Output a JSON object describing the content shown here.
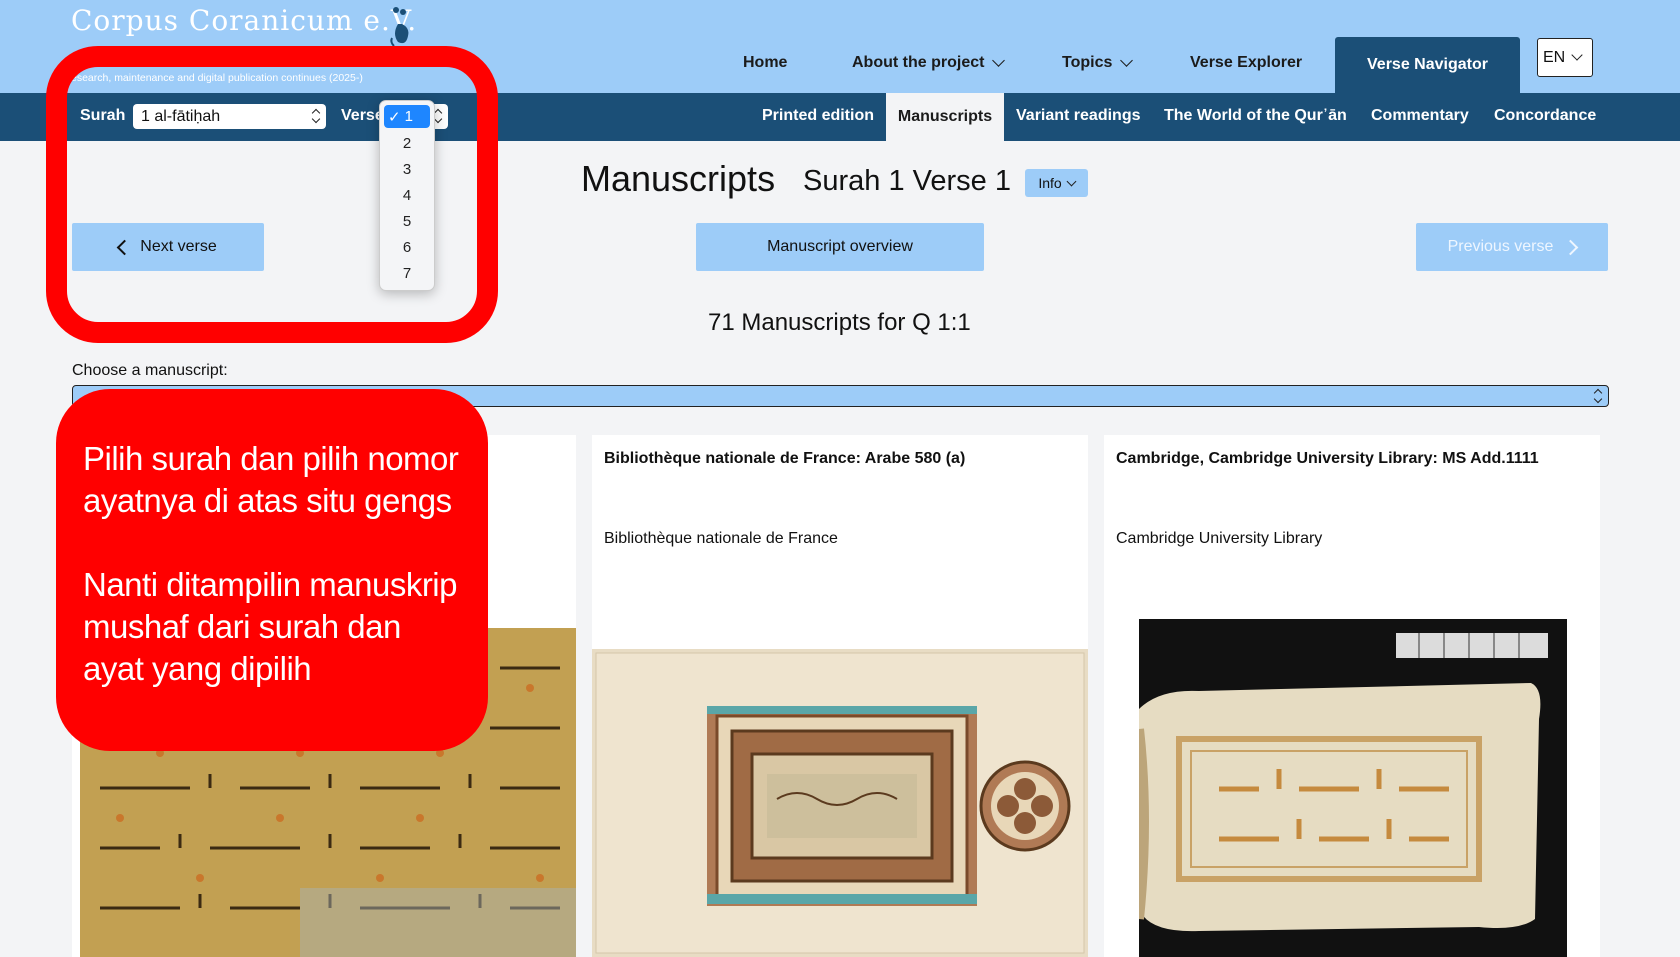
{
  "header": {
    "brand": "Corpus Coranicum e.V.",
    "tagline": "esearch, maintenance and digital publication continues (2025-)",
    "nav": [
      {
        "label": "Home",
        "has_dropdown": false
      },
      {
        "label": "About the project",
        "has_dropdown": true
      },
      {
        "label": "Topics",
        "has_dropdown": true
      },
      {
        "label": "Verse Explorer",
        "has_dropdown": false
      }
    ],
    "nav_active": "Verse Navigator",
    "language": "EN"
  },
  "subbar": {
    "surah_label": "Surah",
    "surah_value": "1 al-fātiḥah",
    "verse_label": "Verse",
    "items": [
      "Printed edition",
      "Variant readings",
      "The World of the Qur᾿ān",
      "Commentary",
      "Concordance"
    ],
    "active_item": "Manuscripts"
  },
  "verse_dropdown": {
    "selected": "1",
    "options": [
      "2",
      "3",
      "4",
      "5",
      "6",
      "7"
    ]
  },
  "main": {
    "title": "Manuscripts",
    "subtitle": "Surah 1 Verse 1",
    "info_label": "Info",
    "next_verse": "Next verse",
    "overview": "Manuscript overview",
    "previous_verse": "Previous verse",
    "count_text": "71 Manuscripts for Q 1:1",
    "choose_label": "Choose a manuscript:"
  },
  "cards": [
    {
      "title": "",
      "library": ""
    },
    {
      "title": "Bibliothèque nationale de France: Arabe 580 (a)",
      "library": "Bibliothèque nationale de France"
    },
    {
      "title": "Cambridge, Cambridge University Library: MS Add.1111",
      "library": "Cambridge University Library"
    }
  ],
  "annotation": {
    "line1": "Pilih surah  dan pilih nomor",
    "line2": "ayatnya di atas situ gengs",
    "line3": "Nanti ditampilin manuskrip",
    "line4": "mushaf dari surah dan",
    "line5": "ayat yang dipilih"
  },
  "colors": {
    "header_bg": "#9dccf8",
    "subbar_bg": "#1b4f77",
    "annotation_red": "#ff0000",
    "dropdown_highlight": "#1e86ff"
  }
}
